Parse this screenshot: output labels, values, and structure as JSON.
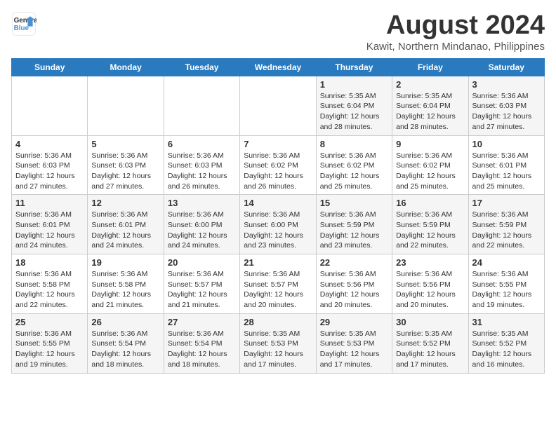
{
  "header": {
    "logo_line1": "General",
    "logo_line2": "Blue",
    "title": "August 2024",
    "subtitle": "Kawit, Northern Mindanao, Philippines"
  },
  "days_of_week": [
    "Sunday",
    "Monday",
    "Tuesday",
    "Wednesday",
    "Thursday",
    "Friday",
    "Saturday"
  ],
  "weeks": [
    [
      {
        "day": "",
        "info": ""
      },
      {
        "day": "",
        "info": ""
      },
      {
        "day": "",
        "info": ""
      },
      {
        "day": "",
        "info": ""
      },
      {
        "day": "1",
        "info": "Sunrise: 5:35 AM\nSunset: 6:04 PM\nDaylight: 12 hours\nand 28 minutes."
      },
      {
        "day": "2",
        "info": "Sunrise: 5:35 AM\nSunset: 6:04 PM\nDaylight: 12 hours\nand 28 minutes."
      },
      {
        "day": "3",
        "info": "Sunrise: 5:36 AM\nSunset: 6:03 PM\nDaylight: 12 hours\nand 27 minutes."
      }
    ],
    [
      {
        "day": "4",
        "info": "Sunrise: 5:36 AM\nSunset: 6:03 PM\nDaylight: 12 hours\nand 27 minutes."
      },
      {
        "day": "5",
        "info": "Sunrise: 5:36 AM\nSunset: 6:03 PM\nDaylight: 12 hours\nand 27 minutes."
      },
      {
        "day": "6",
        "info": "Sunrise: 5:36 AM\nSunset: 6:03 PM\nDaylight: 12 hours\nand 26 minutes."
      },
      {
        "day": "7",
        "info": "Sunrise: 5:36 AM\nSunset: 6:02 PM\nDaylight: 12 hours\nand 26 minutes."
      },
      {
        "day": "8",
        "info": "Sunrise: 5:36 AM\nSunset: 6:02 PM\nDaylight: 12 hours\nand 25 minutes."
      },
      {
        "day": "9",
        "info": "Sunrise: 5:36 AM\nSunset: 6:02 PM\nDaylight: 12 hours\nand 25 minutes."
      },
      {
        "day": "10",
        "info": "Sunrise: 5:36 AM\nSunset: 6:01 PM\nDaylight: 12 hours\nand 25 minutes."
      }
    ],
    [
      {
        "day": "11",
        "info": "Sunrise: 5:36 AM\nSunset: 6:01 PM\nDaylight: 12 hours\nand 24 minutes."
      },
      {
        "day": "12",
        "info": "Sunrise: 5:36 AM\nSunset: 6:01 PM\nDaylight: 12 hours\nand 24 minutes."
      },
      {
        "day": "13",
        "info": "Sunrise: 5:36 AM\nSunset: 6:00 PM\nDaylight: 12 hours\nand 24 minutes."
      },
      {
        "day": "14",
        "info": "Sunrise: 5:36 AM\nSunset: 6:00 PM\nDaylight: 12 hours\nand 23 minutes."
      },
      {
        "day": "15",
        "info": "Sunrise: 5:36 AM\nSunset: 5:59 PM\nDaylight: 12 hours\nand 23 minutes."
      },
      {
        "day": "16",
        "info": "Sunrise: 5:36 AM\nSunset: 5:59 PM\nDaylight: 12 hours\nand 22 minutes."
      },
      {
        "day": "17",
        "info": "Sunrise: 5:36 AM\nSunset: 5:59 PM\nDaylight: 12 hours\nand 22 minutes."
      }
    ],
    [
      {
        "day": "18",
        "info": "Sunrise: 5:36 AM\nSunset: 5:58 PM\nDaylight: 12 hours\nand 22 minutes."
      },
      {
        "day": "19",
        "info": "Sunrise: 5:36 AM\nSunset: 5:58 PM\nDaylight: 12 hours\nand 21 minutes."
      },
      {
        "day": "20",
        "info": "Sunrise: 5:36 AM\nSunset: 5:57 PM\nDaylight: 12 hours\nand 21 minutes."
      },
      {
        "day": "21",
        "info": "Sunrise: 5:36 AM\nSunset: 5:57 PM\nDaylight: 12 hours\nand 20 minutes."
      },
      {
        "day": "22",
        "info": "Sunrise: 5:36 AM\nSunset: 5:56 PM\nDaylight: 12 hours\nand 20 minutes."
      },
      {
        "day": "23",
        "info": "Sunrise: 5:36 AM\nSunset: 5:56 PM\nDaylight: 12 hours\nand 20 minutes."
      },
      {
        "day": "24",
        "info": "Sunrise: 5:36 AM\nSunset: 5:55 PM\nDaylight: 12 hours\nand 19 minutes."
      }
    ],
    [
      {
        "day": "25",
        "info": "Sunrise: 5:36 AM\nSunset: 5:55 PM\nDaylight: 12 hours\nand 19 minutes."
      },
      {
        "day": "26",
        "info": "Sunrise: 5:36 AM\nSunset: 5:54 PM\nDaylight: 12 hours\nand 18 minutes."
      },
      {
        "day": "27",
        "info": "Sunrise: 5:36 AM\nSunset: 5:54 PM\nDaylight: 12 hours\nand 18 minutes."
      },
      {
        "day": "28",
        "info": "Sunrise: 5:35 AM\nSunset: 5:53 PM\nDaylight: 12 hours\nand 17 minutes."
      },
      {
        "day": "29",
        "info": "Sunrise: 5:35 AM\nSunset: 5:53 PM\nDaylight: 12 hours\nand 17 minutes."
      },
      {
        "day": "30",
        "info": "Sunrise: 5:35 AM\nSunset: 5:52 PM\nDaylight: 12 hours\nand 17 minutes."
      },
      {
        "day": "31",
        "info": "Sunrise: 5:35 AM\nSunset: 5:52 PM\nDaylight: 12 hours\nand 16 minutes."
      }
    ]
  ]
}
